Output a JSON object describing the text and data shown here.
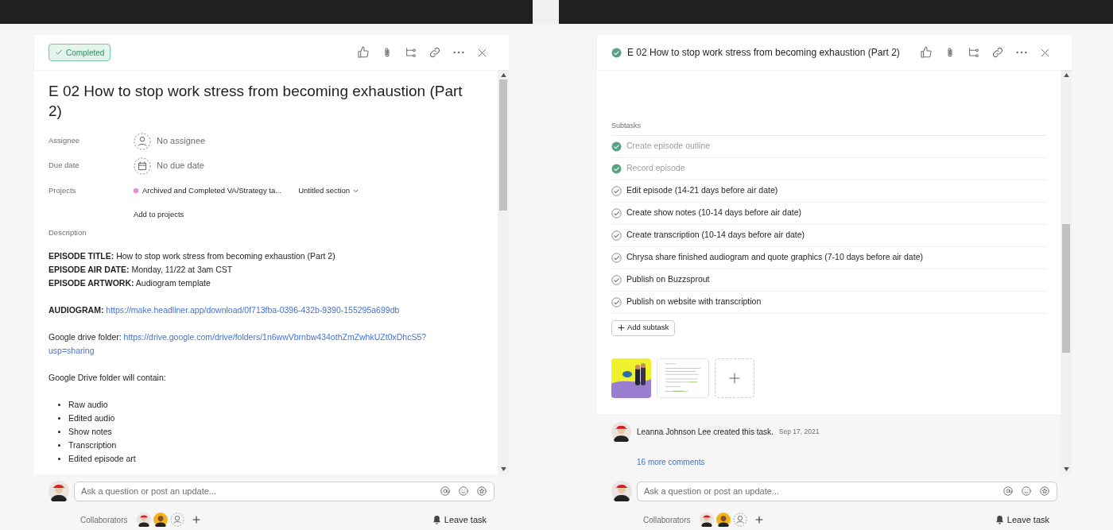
{
  "left_panel": {
    "status_button": {
      "label": "Completed",
      "completed": true
    },
    "title": "E 02 How to stop work stress from becoming exhaustion (Part 2)",
    "fields": [
      {
        "kind": "assignee",
        "label": "Assignee",
        "value": "No assignee"
      },
      {
        "kind": "date",
        "label": "Due date",
        "value": "No due date"
      }
    ],
    "projects": {
      "label": "Projects",
      "project": "Archived and Completed VA/Strategy ta...",
      "color": "#f08ad8",
      "section": "Untitled section",
      "add": "Add to projects"
    },
    "description": {
      "label": "Description",
      "blocks": [
        {
          "kind": "lines",
          "lines": [
            "**EPISODE TITLE:** How to stop work stress from becoming exhaustion (Part 2)",
            "**EPISODE AIR DATE:** Monday, 11/22 at 3am CST",
            "**EPISODE ARTWORK:** Audiogram template"
          ]
        },
        {
          "kind": "link",
          "text": "**AUDIOGRAM:**",
          "link": [
            "https://make.headliner.app/download/0f713fba-0396-432b-9390-155295a699db"
          ]
        },
        {
          "kind": "link",
          "text": "Google drive folder:",
          "link": [
            "https://drive.google.com/drive/folders/1n6wwVbrnbw434othZmZwhkUZt0xDhcS5?",
            "usp=sharing"
          ]
        },
        {
          "kind": "lines",
          "lines": [
            "Google Drive folder will contain:"
          ]
        },
        {
          "kind": "bullets",
          "items": [
            "Raw audio",
            "Edited audio",
            "Show notes",
            "Transcription",
            "Edited episode art"
          ]
        }
      ]
    },
    "comment": {
      "placeholder": "Ask a question or post an update..."
    },
    "collaborators": {
      "label": "Collaborators"
    },
    "leave": "Leave task"
  },
  "right_panel": {
    "title": "E 02 How to stop work stress from becoming exhaustion (Part 2)",
    "completed": true,
    "subtasks_label": "Subtasks",
    "subtasks": [
      {
        "name": "Create episode outline",
        "done": true
      },
      {
        "name": "Record episode",
        "done": true
      },
      {
        "name": "Edit episode (14-21 days before air date)",
        "done": false
      },
      {
        "name": "Create show notes (10-14 days before air date)",
        "done": false
      },
      {
        "name": "Create transcription (10-14 days before air date)",
        "done": false
      },
      {
        "name": "Chrysa share finished audiogram and quote graphics (7-10 days before air date)",
        "done": false
      },
      {
        "name": "Publish on Buzzsprout",
        "done": false
      },
      {
        "name": "Publish on website with transcription",
        "done": false
      }
    ],
    "add_subtask": "Add subtask",
    "activity": {
      "author": "Leanna Johnson Lee",
      "action": "created this task.",
      "date": "Sep 17, 2021",
      "more": "16 more comments"
    },
    "comment": {
      "placeholder": "Ask a question or post an update..."
    },
    "collaborators": {
      "label": "Collaborators"
    },
    "leave": "Leave task"
  }
}
